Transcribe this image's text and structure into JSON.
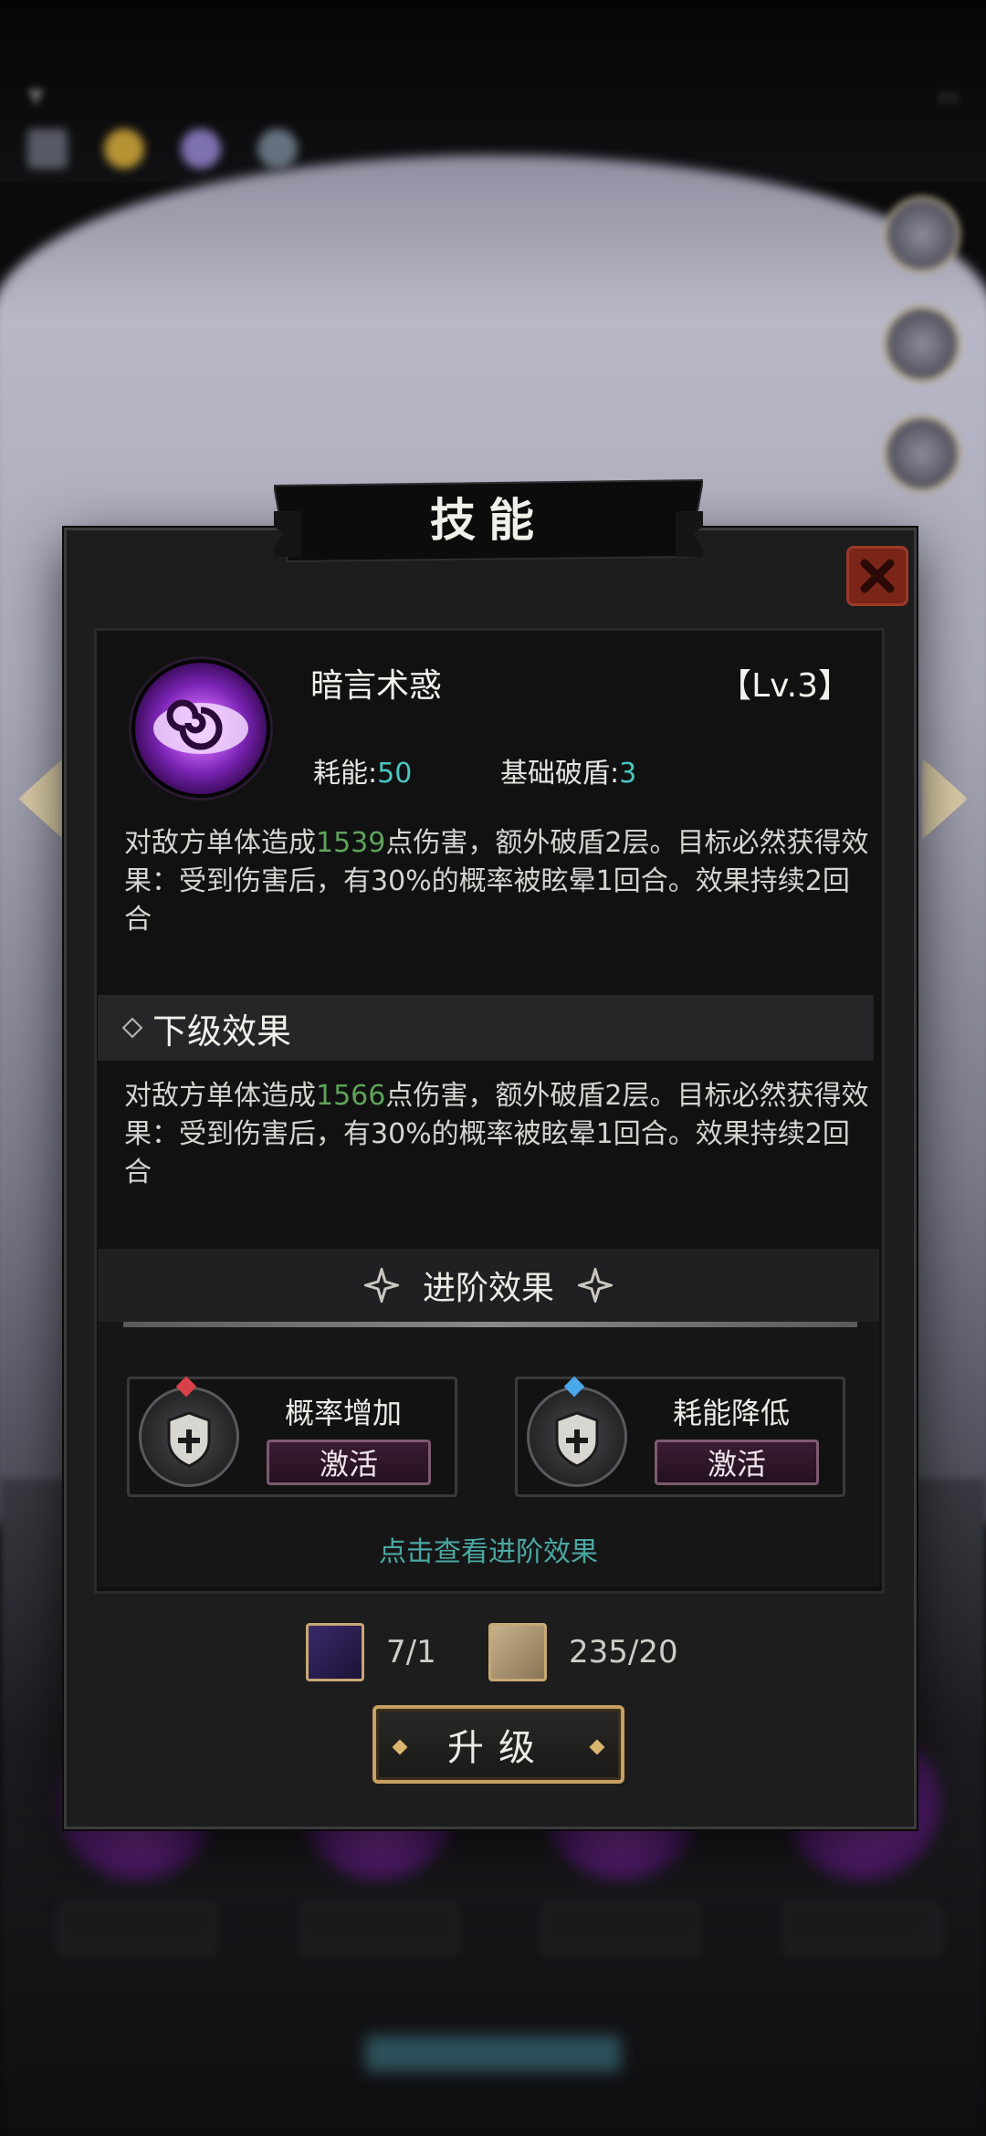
{
  "dialog": {
    "title": "技能",
    "close_icon": "close-icon"
  },
  "skill": {
    "name": "暗言术惑",
    "level": "【Lv.3】",
    "energy_label": "耗能:",
    "energy_value": "50",
    "break_label": "基础破盾:",
    "break_value": "3",
    "desc_part1": "对敌方单体造成",
    "desc_damage": "1539",
    "desc_part2": "点伤害，额外破盾2层。目标必然获得效果：受到伤害后，有30%的概率被眩晕1回合。效果持续2回合"
  },
  "next_level": {
    "title": "下级效果",
    "desc_part1": "对敌方单体造成",
    "desc_damage": "1566",
    "desc_part2": "点伤害，额外破盾2层。目标必然获得效果：受到伤害后，有30%的概率被眩晕1回合。效果持续2回合"
  },
  "advanced": {
    "title": "进阶效果",
    "cards": [
      {
        "name": "概率增加",
        "button": "激活",
        "gem_color": "#d8404a"
      },
      {
        "name": "耗能降低",
        "button": "激活",
        "gem_color": "#4aa8e8"
      }
    ],
    "link": "点击查看进阶效果"
  },
  "costs": [
    {
      "icon": "skill-book-icon",
      "value": "7/1"
    },
    {
      "icon": "scroll-icon",
      "value": "235/20"
    }
  ],
  "upgrade_button": "升级",
  "colors": {
    "highlight_green": "#5fa35a",
    "stat_cyan": "#49c7c0",
    "link_teal": "#4aa8a2",
    "close_red": "#7b2418",
    "gold_border": "#c8a062"
  }
}
